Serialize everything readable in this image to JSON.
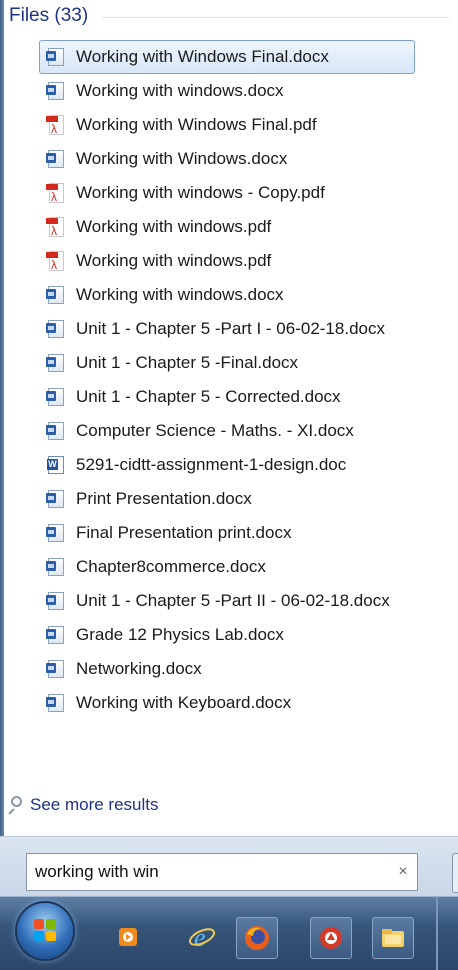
{
  "group": {
    "title": "Files (33)"
  },
  "results": [
    {
      "label": "Working with Windows Final.docx",
      "type": "docx",
      "selected": true
    },
    {
      "label": "Working with windows.docx",
      "type": "docx"
    },
    {
      "label": "Working with Windows Final.pdf",
      "type": "pdf"
    },
    {
      "label": "Working with Windows.docx",
      "type": "docx"
    },
    {
      "label": "Working with windows - Copy.pdf",
      "type": "pdf"
    },
    {
      "label": "Working with windows.pdf",
      "type": "pdf"
    },
    {
      "label": "Working with windows.pdf",
      "type": "pdf"
    },
    {
      "label": "Working with windows.docx",
      "type": "docx"
    },
    {
      "label": "Unit 1 - Chapter 5 -Part I - 06-02-18.docx",
      "type": "docx"
    },
    {
      "label": "Unit 1 - Chapter 5 -Final.docx",
      "type": "docx"
    },
    {
      "label": "Unit 1 - Chapter 5 - Corrected.docx",
      "type": "docx"
    },
    {
      "label": "Computer Science - Maths. - XI.docx",
      "type": "docx"
    },
    {
      "label": "5291-cidtt-assignment-1-design.doc",
      "type": "doc"
    },
    {
      "label": "Print Presentation.docx",
      "type": "docx"
    },
    {
      "label": "Final Presentation print.docx",
      "type": "docx"
    },
    {
      "label": "Chapter8commerce.docx",
      "type": "docx"
    },
    {
      "label": "Unit 1 - Chapter 5 -Part II - 06-02-18.docx",
      "type": "docx"
    },
    {
      "label": "Grade 12 Physics Lab.docx",
      "type": "docx"
    },
    {
      "label": "Networking.docx",
      "type": "docx"
    },
    {
      "label": "Working with Keyboard.docx",
      "type": "docx"
    }
  ],
  "see_more": {
    "label": "See more results",
    "icon": "search-icon"
  },
  "search": {
    "value": "working with win",
    "clear_glyph": "×"
  },
  "taskbar": {
    "items": [
      {
        "name": "start-button",
        "icon": "windows-orb-icon"
      },
      {
        "name": "media-player",
        "icon": "media-player-icon"
      },
      {
        "name": "internet-explorer",
        "icon": "internet-explorer-icon"
      },
      {
        "name": "firefox",
        "icon": "firefox-icon"
      },
      {
        "name": "app",
        "icon": "app-icon"
      },
      {
        "name": "explorer",
        "icon": "folder-icon"
      }
    ]
  },
  "colors": {
    "group_title": "#1e3287",
    "selection_border": "#7da2ce",
    "pdf_red": "#d22a1f",
    "word_blue": "#2d5fa8",
    "taskbar": "#36557a"
  }
}
